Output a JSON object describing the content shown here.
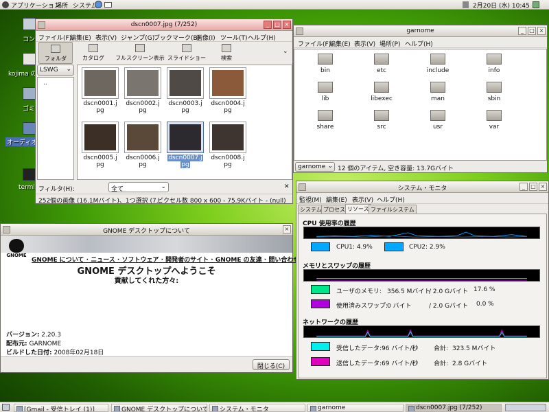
{
  "top_panel": {
    "menus": [
      "アプリケーション",
      "場所",
      "システム"
    ],
    "clock": "2月20日 (水) 10:45"
  },
  "desktop": {
    "icons": [
      "コンピュ",
      "kojima の",
      "ゴミ箱",
      "オーディオ",
      "termi"
    ]
  },
  "eog": {
    "title": "dscn0007.jpg (7/252)",
    "menu": [
      "ファイル(F)",
      "編集(E)",
      "表示(V)",
      "ジャンプ(G)",
      "ブックマーク(B)",
      "画像(I)",
      "ツール(T)",
      "ヘルプ(H)"
    ],
    "toolbar": [
      "フォルダ",
      "カタログ",
      "フルスクリーン表示",
      "スライドショー",
      "検索"
    ],
    "folder_combo": "LSWG",
    "folder_parent": "..",
    "thumbs": [
      {
        "name": "dscn0001.jpg",
        "l1": "dscn0001.j",
        "l2": "pg",
        "color": "#6e6760"
      },
      {
        "name": "dscn0002.jpg",
        "l1": "dscn0002.j",
        "l2": "pg",
        "color": "#7a766f"
      },
      {
        "name": "dscn0003.jpg",
        "l1": "dscn0003.j",
        "l2": "pg",
        "color": "#4f4a45"
      },
      {
        "name": "dscn0004.jpg",
        "l1": "dscn0004.j",
        "l2": "pg",
        "color": "#8a5a3a"
      },
      {
        "name": "dscn0005.jpg",
        "l1": "dscn0005.j",
        "l2": "pg",
        "color": "#3b2f26"
      },
      {
        "name": "dscn0006.jpg",
        "l1": "dscn0006.j",
        "l2": "pg",
        "color": "#5a4838"
      },
      {
        "name": "dscn0007.jpg",
        "l1": "dscn0007.j",
        "l2": "pg",
        "color": "#2c2a2e"
      },
      {
        "name": "dscn0008.jpg",
        "l1": "dscn0008.j",
        "l2": "pg",
        "color": "#3e3530"
      }
    ],
    "filter_label": "フィルタ(H):",
    "filter_value": "全て",
    "status": "252個の画像 (16.1Mバイト)、1つ選択 (7...",
    "status_right": "ピクセル数 800 x 600 - 75.9Kバイト - (null)"
  },
  "garnome": {
    "title": "garnome",
    "menu": [
      "ファイル(F)",
      "編集(E)",
      "表示(V)",
      "場所(P)",
      "ヘルプ(H)"
    ],
    "folders": [
      "bin",
      "etc",
      "include",
      "info",
      "lib",
      "libexec",
      "man",
      "sbin",
      "share",
      "src",
      "usr",
      "var"
    ],
    "location": "garnome",
    "status": "12 個のアイテム, 空き容量: 13.7Gバイト"
  },
  "about": {
    "title": "GNOME デスクトップについて",
    "logo_text": "GNOME",
    "nav": "GNOME について · ニュース · ソフトウェア · 開発者のサイト · GNOME の友達 · 問い合わせ先",
    "welcome": "GNOME デスクトップへようこそ",
    "contributors": "貢献してくれた方々:",
    "version_label": "バージョン:",
    "version": "2.20.3",
    "distributor_label": "配布元:",
    "distributor": "GARNOME",
    "build_date_label": "ビルドした日付:",
    "build_date": "2008年02月18日",
    "close_button": "閉じる(C)"
  },
  "sysmon": {
    "title": "システム・モニタ",
    "menu": [
      "監視(M)",
      "編集(E)",
      "表示(V)",
      "ヘルプ(H)"
    ],
    "tabs": [
      "システム",
      "プロセス",
      "リソース",
      "ファイルシステム"
    ],
    "active_tab": "リソース",
    "cpu_title": "CPU 使用率の履歴",
    "cpu1": "CPU1:   4.9%",
    "cpu2": "CPU2:   2.9%",
    "mem_title": "メモリとスワップの履歴",
    "user_mem_label": "ユーザのメモリ:",
    "user_mem_value": "356.5 Mバイト",
    "user_mem_total": "/   2.0 Gバイト",
    "user_mem_pct": "17.6 %",
    "swap_label": "使用済みスワップ:",
    "swap_value": "0 バイト",
    "swap_total": "/   2.0 Gバイト",
    "swap_pct": "0.0 %",
    "net_title": "ネットワークの履歴",
    "recv_label": "受信したデータ:",
    "recv_rate": "96 バイト/秒",
    "recv_total_label": "合計:",
    "recv_total": "323.5 Mバイト",
    "sent_label": "送信したデータ:",
    "sent_rate": "69 バイト/秒",
    "sent_total_label": "合計:",
    "sent_total": "2.8 Gバイト",
    "colors": {
      "cpu1": "#00a8ff",
      "cpu2": "#00a8ff",
      "mem": "#00e68c",
      "swap": "#b000e0",
      "recv": "#00f0f0",
      "sent": "#e000c0"
    }
  },
  "taskbar": {
    "tasks": [
      "[Gmail - 受信トレイ (1)]",
      "GNOME デスクトップについて",
      "システム・モニタ",
      "garnome",
      "dscn0007.jpg (7/252)"
    ]
  }
}
